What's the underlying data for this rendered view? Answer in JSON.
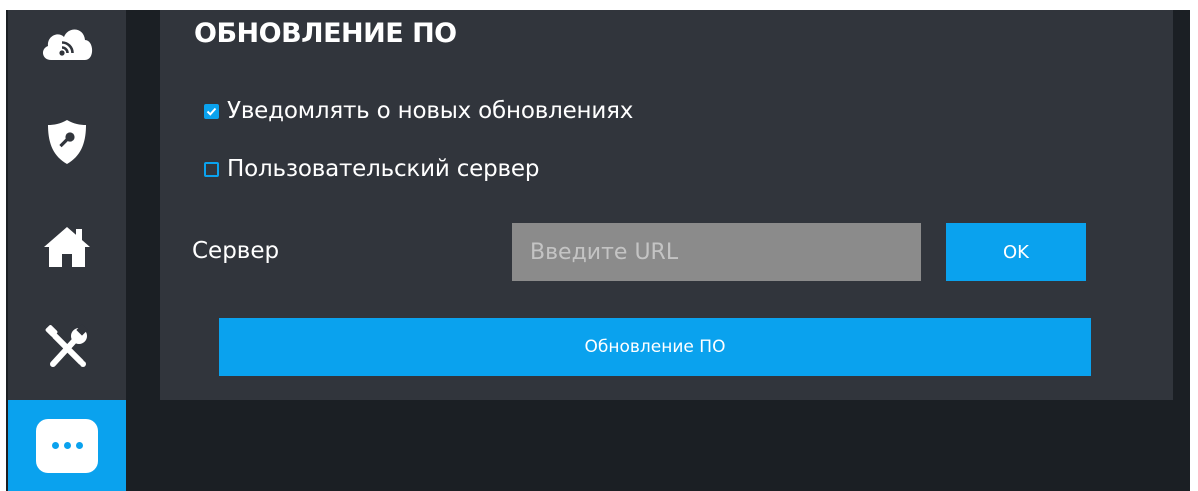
{
  "sidebar": {
    "items": [
      {
        "icon": "cloud-wifi-icon"
      },
      {
        "icon": "shield-key-icon"
      },
      {
        "icon": "home-icon"
      },
      {
        "icon": "tools-icon"
      },
      {
        "icon": "more-icon",
        "active": true
      }
    ]
  },
  "panel": {
    "title": "ОБНОВЛЕНИЕ ПО",
    "notify_checkbox": {
      "label": "Уведомлять о новых обновлениях",
      "checked": true
    },
    "custom_server_checkbox": {
      "label": "Пользовательский сервер",
      "checked": false
    },
    "server": {
      "label": "Сервер",
      "value": "",
      "placeholder": "Введите URL",
      "ok_label": "OK"
    },
    "update_button_label": "Обновление ПО"
  },
  "colors": {
    "accent": "#0aa2ee",
    "panel_bg": "#31353c",
    "screen_bg": "#1b1f24",
    "input_bg": "#8b8b8b"
  }
}
